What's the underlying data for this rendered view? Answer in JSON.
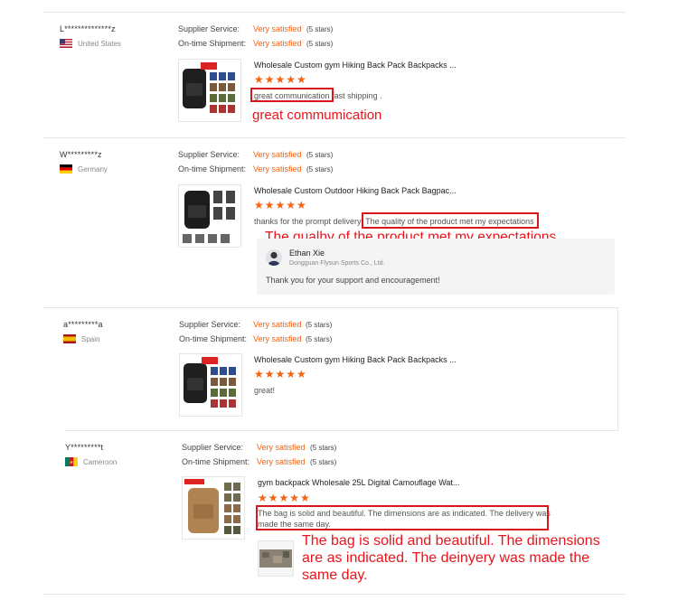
{
  "common": {
    "supplier_service_label": "Supplier Service:",
    "ontime_shipment_label": "On-time Shipment:",
    "rating_value": "Very satisfied",
    "rating_stars_text": "(5 stars)",
    "star_glyphs": "★★★★★",
    "accent_color": "#f5620f",
    "highlight_color": "#d8171c"
  },
  "reviews": [
    {
      "user": "L**************z",
      "country": "United States",
      "flag": "us-flag-icon",
      "product_title": "Wholesale Custom gym Hiking Back Pack Backpacks ...",
      "review_highlight": "great communication",
      "review_rest": "fast shipping .",
      "annotation": "great commumication"
    },
    {
      "user": "W*********z",
      "country": "Germany",
      "flag": "germany-flag-icon",
      "product_title": "Wholesale Custom Outdoor Hiking Back Pack Bagpac...",
      "review_start": "thanks for the prompt delivery",
      "review_highlight": "The quality of the product met my expectations",
      "annotation": "The qualhy of the product met my expectations",
      "reply": {
        "name": "Ethan Xie",
        "company": "Dongguan Flysun Sports Co., Ltd.",
        "message": "Thank you for your support and encouragement!"
      }
    },
    {
      "user": "a*********a",
      "country": "Spain",
      "flag": "spain-flag-icon",
      "product_title": "Wholesale Custom gym Hiking Back Pack Backpacks ...",
      "review": "great!"
    },
    {
      "user": "Y*********t",
      "country": "Cameroon",
      "flag": "cameroon-flag-icon",
      "product_title": "gym backpack Wholesale 25L Digital Camouflage Wat...",
      "review_line1": "The bag is solid and beautiful. The dimensions are as indicated. The delivery was",
      "review_line2": "made the same day.",
      "annotation_line1": "The bag is solid and beautiful. The dimensions",
      "annotation_line2": "are as indicated. The deinyery was made the",
      "annotation_line3": "same day."
    }
  ]
}
